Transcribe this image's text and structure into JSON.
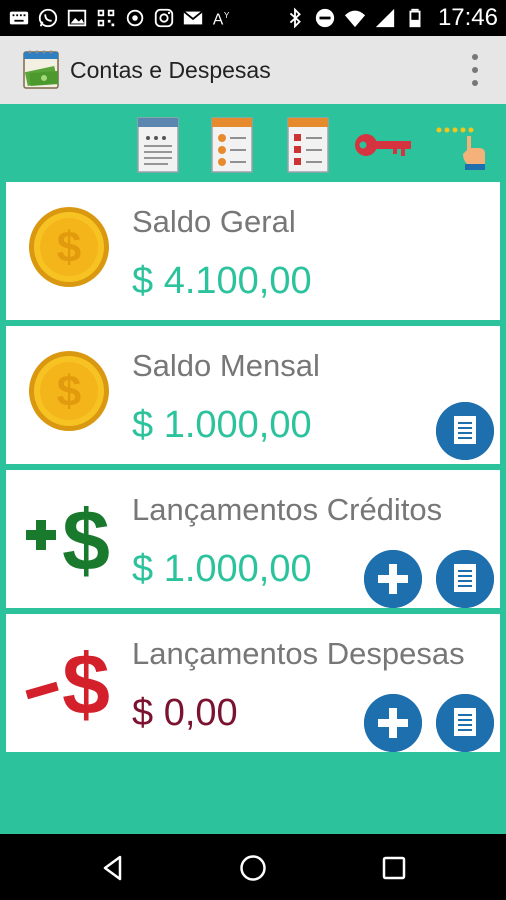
{
  "status_bar": {
    "time": "17:46",
    "left_icons": [
      "keyboard-icon",
      "whatsapp-icon",
      "image-icon",
      "qr-code-icon",
      "vpn-icon",
      "instagram-icon",
      "gmail-icon",
      "font-icon"
    ],
    "right_icons": [
      "bluetooth-icon",
      "do-not-disturb-icon",
      "wifi-icon",
      "signal-icon",
      "battery-icon"
    ]
  },
  "app_bar": {
    "title": "Contas e Despesas",
    "logo_icon": "money-notebook-icon",
    "menu_icon": "overflow-menu-icon"
  },
  "toolbar": {
    "buttons": [
      {
        "name": "report-icon"
      },
      {
        "name": "credit-report-icon"
      },
      {
        "name": "expense-report-icon"
      },
      {
        "name": "key-icon"
      },
      {
        "name": "rate-stars-icon"
      }
    ]
  },
  "cards": [
    {
      "label": "Saldo Geral",
      "value": "$ 4.100,00",
      "icon": "gold-coin-icon",
      "actions": []
    },
    {
      "label": "Saldo Mensal",
      "value": "$ 1.000,00",
      "icon": "gold-coin-icon",
      "actions": [
        "report"
      ]
    },
    {
      "label": "Lançamentos Créditos",
      "value": "$ 1.000,00",
      "icon": "plus-dollar-icon",
      "actions": [
        "add",
        "report"
      ]
    },
    {
      "label": "Lançamentos Despesas",
      "value": "$ 0,00",
      "icon": "minus-dollar-icon",
      "actions": [
        "add",
        "report"
      ]
    }
  ],
  "colors": {
    "teal": "#2cc39c",
    "positive_value": "#2cc39c",
    "negative_value": "#7b1330",
    "action_blue": "#1e6fae",
    "app_bar": "#e6e6e6"
  },
  "nav_bar": {
    "buttons": [
      "back-icon",
      "home-icon",
      "recents-icon"
    ]
  }
}
